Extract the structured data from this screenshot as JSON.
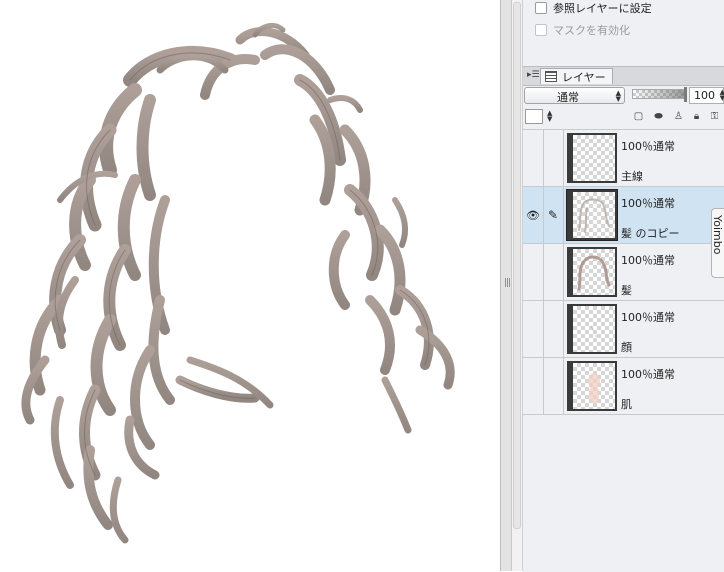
{
  "options": {
    "reference_layer_label": "参照レイヤーに設定",
    "mask_label": "マスクを有効化"
  },
  "layer_panel": {
    "tab_label": "レイヤー",
    "blend_mode": "通常",
    "opacity_value": "100",
    "layers": [
      {
        "props": "100％通常",
        "name": "主線",
        "visible": false,
        "selected": false
      },
      {
        "props": "100％通常",
        "name": "髪 のコピー",
        "visible": true,
        "selected": true
      },
      {
        "props": "100％通常",
        "name": "髪",
        "visible": false,
        "selected": false
      },
      {
        "props": "100％通常",
        "name": "顔",
        "visible": false,
        "selected": false
      },
      {
        "props": "100％通常",
        "name": "肌",
        "visible": false,
        "selected": false
      }
    ]
  },
  "side_tab_label": "Yoimbo",
  "colors": {
    "hair": "#8e7f76",
    "selection": "#cfe3f3",
    "panel_bg": "#eef0f3"
  },
  "icons": [
    "panel-menu-icon",
    "layer-palette-icon",
    "eye-icon",
    "pen-icon",
    "new-layer-icon",
    "mask-icon",
    "figure-icon",
    "lock-icon",
    "clip-icon"
  ]
}
